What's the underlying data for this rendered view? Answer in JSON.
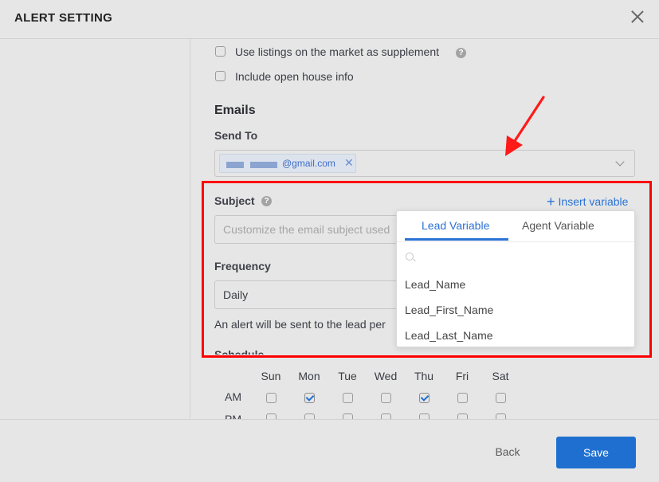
{
  "dialog": {
    "title": "ALERT SETTING"
  },
  "options": {
    "supplement_label": "Use listings on the market as supplement",
    "open_house_label": "Include open house info"
  },
  "emails": {
    "heading": "Emails",
    "send_to_label": "Send To",
    "recipient_chip": "@gmail.com"
  },
  "subject": {
    "label": "Subject",
    "placeholder": "Customize the email subject used",
    "insert_variable": "Insert variable"
  },
  "variable_menu": {
    "tabs": [
      "Lead Variable",
      "Agent Variable"
    ],
    "items": [
      "Lead_Name",
      "Lead_First_Name",
      "Lead_Last_Name"
    ]
  },
  "frequency": {
    "label": "Frequency",
    "value": "Daily",
    "hint": "An alert will be sent to the lead per"
  },
  "schedule": {
    "label": "Schedule",
    "days": [
      "Sun",
      "Mon",
      "Tue",
      "Wed",
      "Thu",
      "Fri",
      "Sat"
    ],
    "am_label": "AM",
    "pm_label": "PM",
    "am_checked": [
      false,
      true,
      false,
      false,
      true,
      false,
      false
    ]
  },
  "footer": {
    "back_label": "Back",
    "save_label": "Save"
  },
  "colors": {
    "accent": "#1f6fd1",
    "highlight": "#ff0000"
  }
}
